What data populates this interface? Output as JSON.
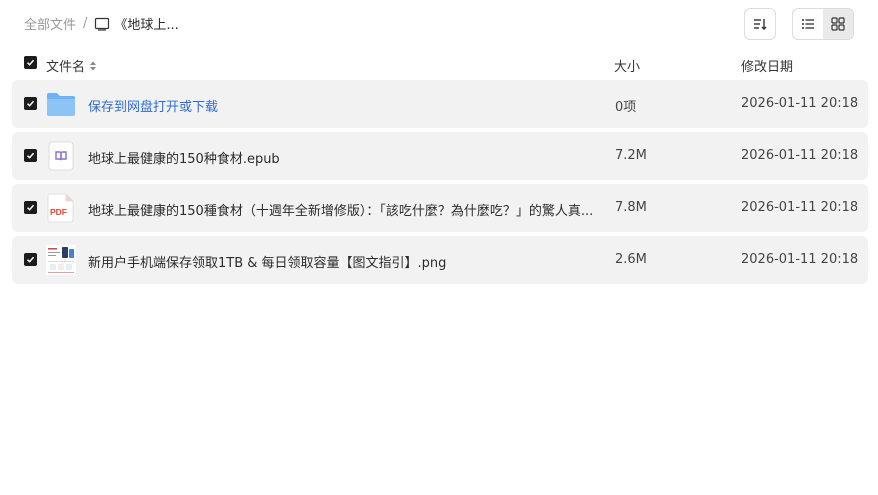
{
  "breadcrumb": {
    "root": "全部文件",
    "separator": "/",
    "current": "《地球上..."
  },
  "toolbar": {
    "sort_icon": "sort-descending-icon",
    "view_list_icon": "list-view-icon",
    "view_grid_icon": "grid-view-icon",
    "active_view": "grid"
  },
  "columns": {
    "name": "文件名",
    "size": "大小",
    "date": "修改日期"
  },
  "files": [
    {
      "name": "保存到网盘打开或下载",
      "size": "0项",
      "date": "2026-01-11 20:18",
      "type": "folder",
      "icon": "folder-icon"
    },
    {
      "name": "地球上最健康的150种食材.epub",
      "size": "7.2M",
      "date": "2026-01-11 20:18",
      "type": "epub",
      "icon": "epub-icon"
    },
    {
      "name": "地球上最健康的150種食材（十週年全新增修版）：「該吃什麼？為什麼吃？」的驚人真...",
      "size": "7.8M",
      "date": "2026-01-11 20:18",
      "type": "pdf",
      "icon": "pdf-icon",
      "badge": "PDF"
    },
    {
      "name": "新用户手机端保存领取1TB & 每日领取容量【图文指引】.png",
      "size": "2.6M",
      "date": "2026-01-11 20:18",
      "type": "png",
      "icon": "image-thumbnail-icon"
    }
  ],
  "colors": {
    "accent_link": "#2f6bd6",
    "row_bg": "#f2f2f2",
    "checkbox": "#1c1c1c",
    "folder": "#6fb3f2",
    "pdf": "#e8443a",
    "epub": "#8a6fd1"
  }
}
